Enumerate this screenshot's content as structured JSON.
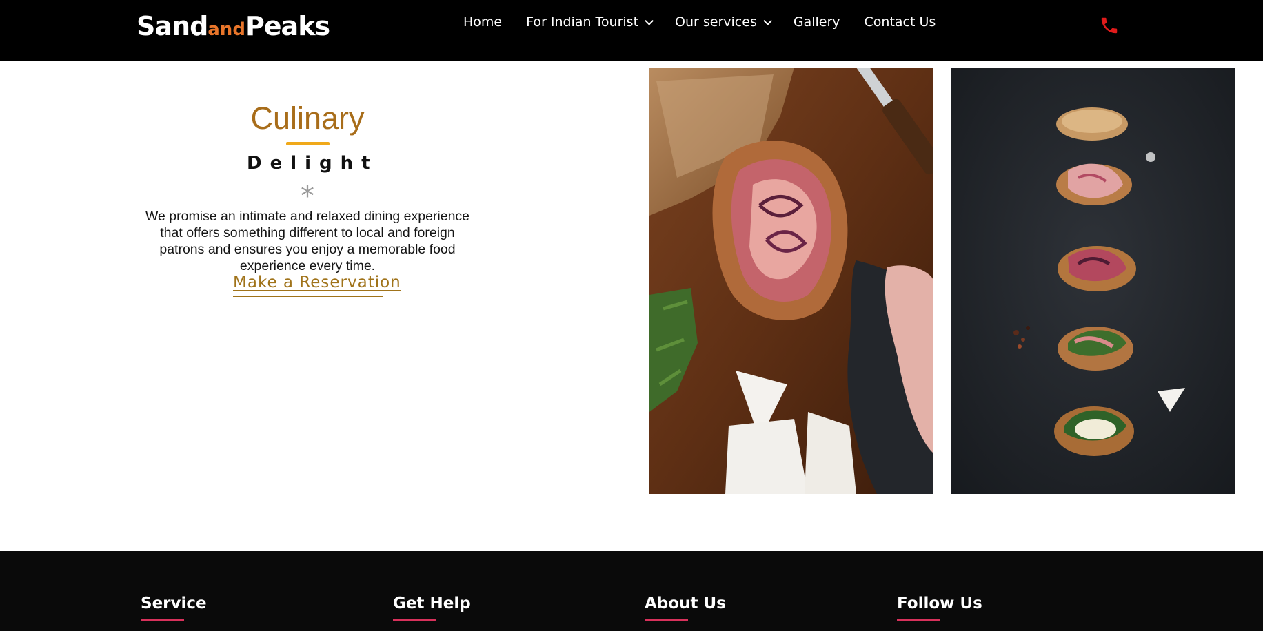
{
  "header": {
    "logo": {
      "part1": "Sand",
      "part2": "and",
      "part3": "Peaks"
    },
    "nav": [
      {
        "label": "Home",
        "has_dropdown": false
      },
      {
        "label": "For Indian Tourist",
        "has_dropdown": true
      },
      {
        "label": "Our services",
        "has_dropdown": true
      },
      {
        "label": "Gallery",
        "has_dropdown": false
      },
      {
        "label": "Contact Us",
        "has_dropdown": false
      }
    ],
    "phone_icon": "phone-icon"
  },
  "culinary": {
    "title": "Culinary",
    "subtitle": "Delight",
    "ornament": "*",
    "description": "We promise an intimate and relaxed dining experience that offers something different to local and foreign patrons and ensures you enjoy a memorable food experience every time.",
    "cta": "Make a Reservation"
  },
  "footer": {
    "columns": [
      "Service",
      "Get Help",
      "About Us",
      "Follow Us"
    ]
  },
  "colors": {
    "header_bg": "#000000",
    "logo_accent": "#e8752a",
    "title": "#a86d1a",
    "title_underline": "#f0a91a",
    "cta": "#a0731a",
    "phone_icon": "#e01b1b",
    "footer_bg": "#0a0a0a",
    "footer_underline": "#d8315b"
  }
}
